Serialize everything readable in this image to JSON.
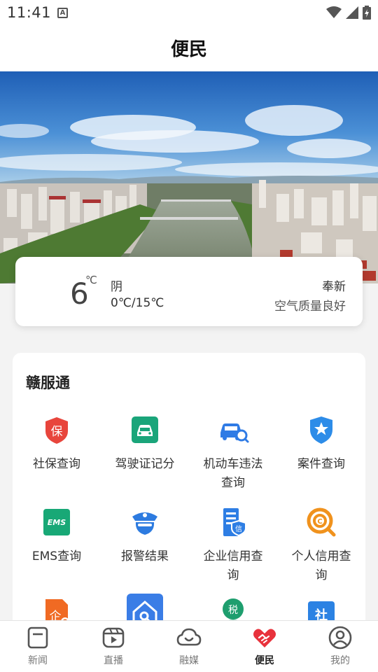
{
  "status_bar": {
    "time": "11:41",
    "notification_glyph": "A"
  },
  "header": {
    "title": "便民"
  },
  "weather": {
    "temperature": "6",
    "unit": "℃",
    "condition": "阴",
    "range": "0℃/15℃",
    "city": "奉新",
    "air_quality": "空气质量良好"
  },
  "services": {
    "title": "赣服通",
    "items": [
      {
        "label": "社保查询",
        "icon": "insurance-icon",
        "color": "#e8453c",
        "glyph": "保"
      },
      {
        "label": "驾驶证记分",
        "icon": "license-icon",
        "color": "#1aa57a"
      },
      {
        "label": "机动车违法查询",
        "icon": "car-search-icon",
        "color": "#2f7be5"
      },
      {
        "label": "案件查询",
        "icon": "shield-star-icon",
        "color": "#2d8ce8"
      },
      {
        "label": "EMS查询",
        "icon": "ems-icon",
        "color": "#18a876",
        "glyph": "EMS"
      },
      {
        "label": "报警结果",
        "icon": "police-icon",
        "color": "#2d7be0"
      },
      {
        "label": "企业信用查询",
        "icon": "enterprise-credit-icon",
        "color": "#2e7ee4",
        "glyph": "信"
      },
      {
        "label": "个人信用查询",
        "icon": "personal-credit-icon",
        "color": "#f0921d",
        "glyph": "C"
      },
      {
        "label": "",
        "icon": "enterprise-icon",
        "color": "#f06a23",
        "glyph": "企"
      },
      {
        "label": "",
        "icon": "house-search-icon",
        "color": "#3a7de6"
      },
      {
        "label": "",
        "icon": "tax-icon",
        "color": "#1e9e6e",
        "glyph": "税"
      },
      {
        "label": "",
        "icon": "social-icon",
        "color": "#2b82e3",
        "glyph": "社"
      }
    ]
  },
  "bottom_nav": [
    {
      "label": "新闻",
      "icon": "news-icon",
      "active": false
    },
    {
      "label": "直播",
      "icon": "live-icon",
      "active": false
    },
    {
      "label": "融媒",
      "icon": "media-cloud-icon",
      "active": false
    },
    {
      "label": "便民",
      "icon": "convenience-hands-icon",
      "active": true
    },
    {
      "label": "我的",
      "icon": "profile-icon",
      "active": false
    }
  ],
  "colors": {
    "accent": "#e8323c",
    "background": "#f3f3f3"
  }
}
